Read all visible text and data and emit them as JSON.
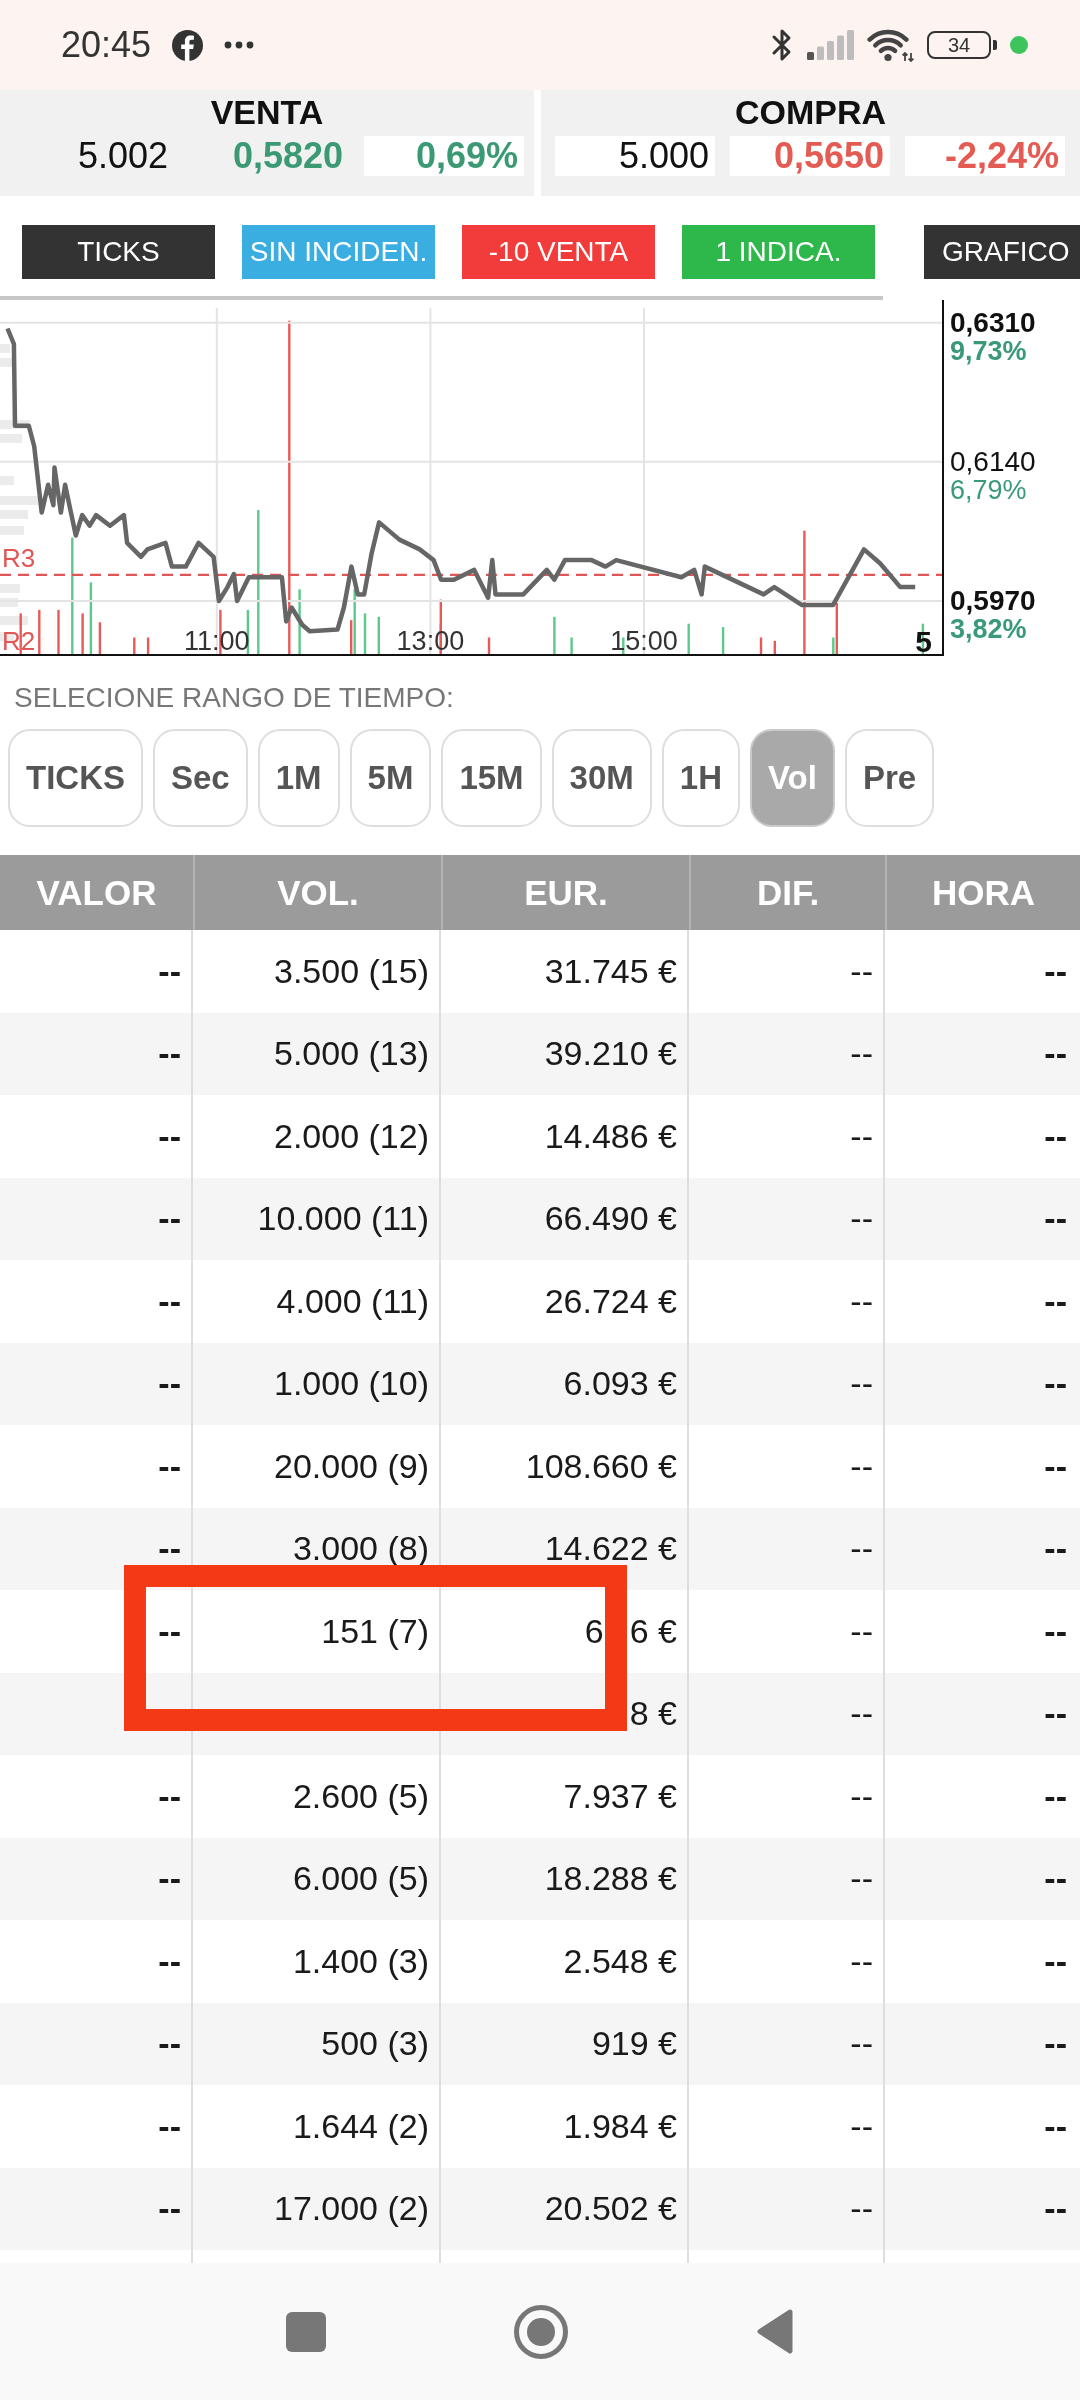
{
  "status_bar": {
    "time": "20:45",
    "battery": "34"
  },
  "quote_panels": [
    {
      "title": "VENTA",
      "values": [
        {
          "text": "5.002",
          "color": "#111111",
          "highlighted": false
        },
        {
          "text": "0,5820",
          "color": "#3b9a74",
          "highlighted": false
        },
        {
          "text": "0,69%",
          "color": "#3b9a74",
          "highlighted": true
        }
      ]
    },
    {
      "title": "COMPRA",
      "values": [
        {
          "text": "5.000",
          "color": "#111111",
          "highlighted": true
        },
        {
          "text": "0,5650",
          "color": "#e35b53",
          "highlighted": true
        },
        {
          "text": "-2,24%",
          "color": "#e35b53",
          "highlighted": true
        }
      ]
    }
  ],
  "signal_tags": [
    {
      "label": "TICKS",
      "color": "#333333"
    },
    {
      "label": "SIN INCIDEN.",
      "color": "#3aaee0"
    },
    {
      "label": "-10 VENTA",
      "color": "#f23b3b"
    },
    {
      "label": "1 INDICA.",
      "color": "#2eb84b"
    },
    {
      "label": "GRAFICO",
      "color": "#333333"
    }
  ],
  "chart": {
    "chart_data": {
      "type": "line",
      "x": [
        9.04,
        9.1,
        9.11,
        9.24,
        9.29,
        9.36,
        9.42,
        9.47,
        9.48,
        9.54,
        9.58,
        9.62,
        9.68,
        9.74,
        9.81,
        9.87,
        10.0,
        10.13,
        10.16,
        10.29,
        10.35,
        10.52,
        10.58,
        10.71,
        10.83,
        10.97,
        11.02,
        11.1,
        11.16,
        11.19,
        11.3,
        11.61,
        11.65,
        11.7,
        11.8,
        11.87,
        12.13,
        12.19,
        12.26,
        12.32,
        12.38,
        12.45,
        12.52,
        12.71,
        12.9,
        13.03,
        13.1,
        13.22,
        13.41,
        13.54,
        13.58,
        13.61,
        13.87,
        14.09,
        14.16,
        14.26,
        14.51,
        14.64,
        14.74,
        15.35,
        15.47,
        15.54,
        15.57,
        16.12,
        16.22,
        16.48,
        16.77,
        17.06,
        17.21,
        17.4,
        17.54
      ],
      "series": [
        {
          "color": "#666666",
          "values": [
            0.6303,
            0.6284,
            0.6184,
            0.6184,
            0.6159,
            0.6078,
            0.6112,
            0.6087,
            0.6133,
            0.6078,
            0.6112,
            0.6087,
            0.605,
            0.6075,
            0.6062,
            0.6075,
            0.6062,
            0.6075,
            0.6041,
            0.6024,
            0.6033,
            0.6041,
            0.6012,
            0.6012,
            0.6041,
            0.6024,
            0.597,
            0.5987,
            0.6003,
            0.597,
            0.5999,
            0.5999,
            0.5945,
            0.5962,
            0.5941,
            0.5933,
            0.5935,
            0.5962,
            0.6012,
            0.5978,
            0.5978,
            0.6028,
            0.6066,
            0.6045,
            0.6033,
            0.602,
            0.5996,
            0.5996,
            0.6008,
            0.5974,
            0.602,
            0.5978,
            0.5978,
            0.6008,
            0.5996,
            0.602,
            0.602,
            0.6012,
            0.602,
            0.5999,
            0.6008,
            0.5978,
            0.6012,
            0.5978,
            0.5987,
            0.5965,
            0.5965,
            0.6033,
            0.6016,
            0.5987,
            0.5987
          ]
        }
      ],
      "xlim": [
        8.97,
        17.8
      ],
      "ylim": [
        0.5904,
        0.6328
      ],
      "xticks": [
        {
          "value": 11,
          "label": "11:00"
        },
        {
          "value": 13,
          "label": "13:00"
        },
        {
          "value": 15,
          "label": "15:00"
        }
      ],
      "yticks": [
        {
          "value": 0.631,
          "label": "0,6310"
        },
        {
          "value": 0.614,
          "label": "0,6140"
        },
        {
          "value": 0.597,
          "label": "0,5970"
        }
      ],
      "grid": true,
      "ref_lines": [
        {
          "axis": "y",
          "value": 0.6002,
          "label": "R3"
        }
      ]
    },
    "percent_labels": [
      "9,73%",
      "6,79%",
      "3,82%"
    ],
    "edge_label": "R2",
    "corner_label": "5"
  },
  "time_range": {
    "label": "SELECIONE RANGO DE TIEMPO:",
    "options": [
      {
        "label": "TICKS",
        "selected": false
      },
      {
        "label": "Sec",
        "selected": false
      },
      {
        "label": "1M",
        "selected": false
      },
      {
        "label": "5M",
        "selected": false
      },
      {
        "label": "15M",
        "selected": false
      },
      {
        "label": "30M",
        "selected": false
      },
      {
        "label": "1H",
        "selected": false
      },
      {
        "label": "Vol",
        "selected": true
      },
      {
        "label": "Pre",
        "selected": false
      }
    ]
  },
  "table": {
    "columns": [
      "VALOR",
      "VOL.",
      "EUR.",
      "DIF.",
      "HORA"
    ],
    "rows": [
      {
        "valor": "--",
        "vol": "3.500 (15)",
        "eur": "31.745 €",
        "dif": "--",
        "hora": "--",
        "annotated": false
      },
      {
        "valor": "--",
        "vol": "5.000 (13)",
        "eur": "39.210 €",
        "dif": "--",
        "hora": "--",
        "annotated": false
      },
      {
        "valor": "--",
        "vol": "2.000 (12)",
        "eur": "14.486 €",
        "dif": "--",
        "hora": "--",
        "annotated": false
      },
      {
        "valor": "--",
        "vol": "10.000 (11)",
        "eur": "66.490 €",
        "dif": "--",
        "hora": "--",
        "annotated": false
      },
      {
        "valor": "--",
        "vol": "4.000 (11)",
        "eur": "26.724 €",
        "dif": "--",
        "hora": "--",
        "annotated": false
      },
      {
        "valor": "--",
        "vol": "1.000 (10)",
        "eur": "6.093 €",
        "dif": "--",
        "hora": "--",
        "annotated": false
      },
      {
        "valor": "--",
        "vol": "20.000 (9)",
        "eur": "108.660 €",
        "dif": "--",
        "hora": "--",
        "annotated": false
      },
      {
        "valor": "--",
        "vol": "3.000 (8)",
        "eur": "14.622 €",
        "dif": "--",
        "hora": "--",
        "annotated": false
      },
      {
        "valor": "--",
        "vol": "151 (7)",
        "eur": [
          "6",
          "6 €"
        ],
        "dif": "--",
        "hora": "--",
        "annotated": true
      },
      {
        "eur": "8 €",
        "dif": "--",
        "hora": "--",
        "annotated": false
      },
      {
        "valor": "--",
        "vol": "2.600 (5)",
        "eur": "7.937 €",
        "dif": "--",
        "hora": "--",
        "annotated": false
      },
      {
        "valor": "--",
        "vol": "6.000 (5)",
        "eur": "18.288 €",
        "dif": "--",
        "hora": "--",
        "annotated": false
      },
      {
        "valor": "--",
        "vol": "1.400 (3)",
        "eur": "2.548 €",
        "dif": "--",
        "hora": "--",
        "annotated": false
      },
      {
        "valor": "--",
        "vol": "500 (3)",
        "eur": "919 €",
        "dif": "--",
        "hora": "--",
        "annotated": false
      },
      {
        "valor": "--",
        "vol": "1.644 (2)",
        "eur": "1.984 €",
        "dif": "--",
        "hora": "--",
        "annotated": false
      },
      {
        "valor": "--",
        "vol": "17.000 (2)",
        "eur": "20.502 €",
        "dif": "--",
        "hora": "--",
        "annotated": false
      }
    ]
  }
}
